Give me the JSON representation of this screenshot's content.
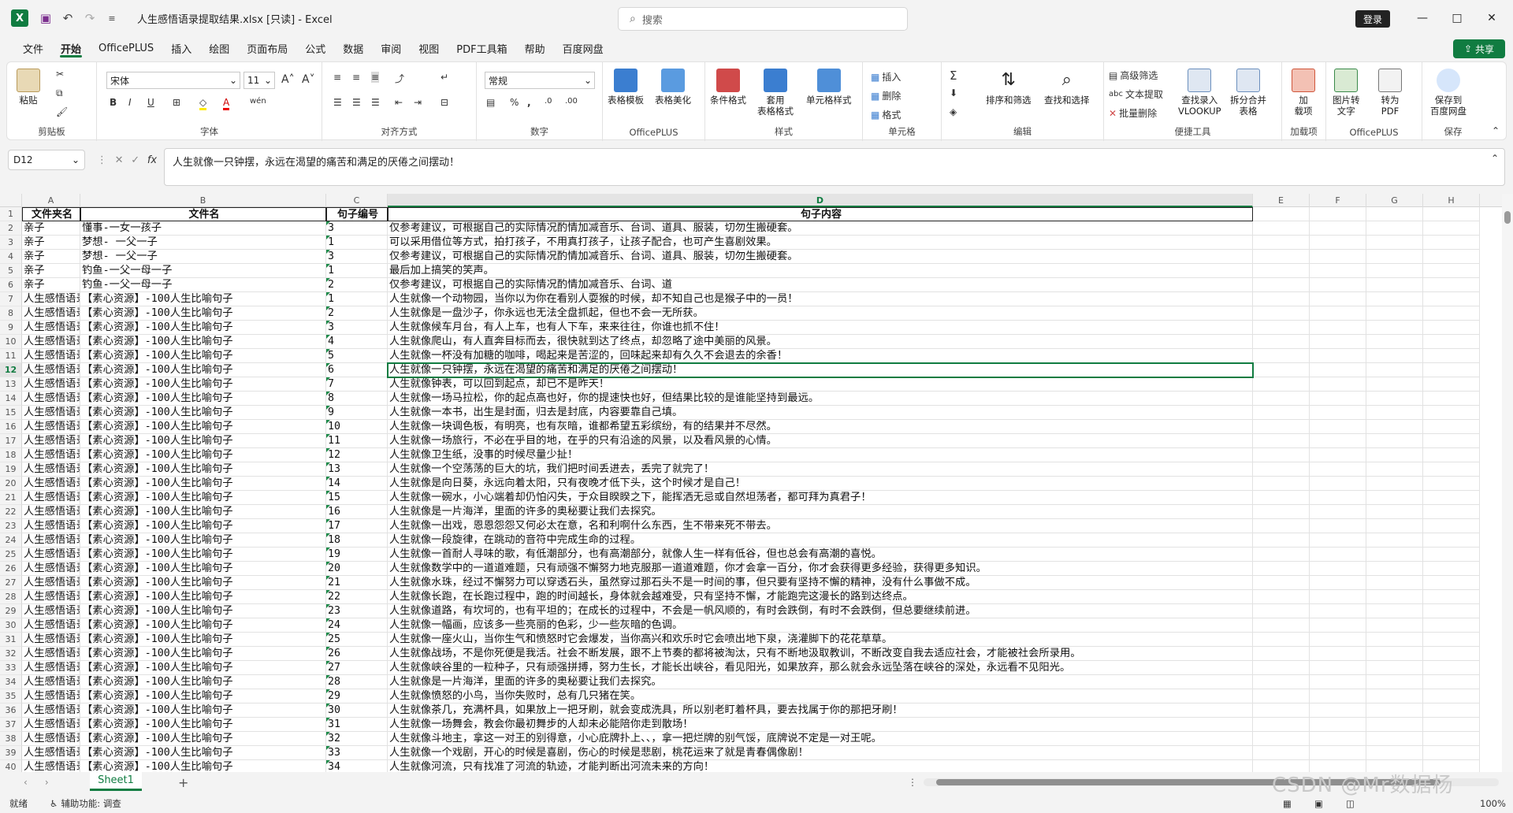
{
  "title_bar": {
    "doc_title": "人生感悟语录提取结果.xlsx  [只读]  -  Excel",
    "search_placeholder": "搜索",
    "login_label": "登录",
    "minimize_glyph": "—",
    "maximize_glyph": "□",
    "close_glyph": "✕",
    "undo_glyph": "↶",
    "redo_glyph": "↷",
    "qat_glyph": "≡",
    "logo_letter": "X"
  },
  "menu": {
    "items": [
      "文件",
      "开始",
      "OfficePLUS",
      "插入",
      "绘图",
      "页面布局",
      "公式",
      "数据",
      "审阅",
      "视图",
      "PDF工具箱",
      "帮助",
      "百度网盘"
    ],
    "active_index": 1,
    "share_label": "共享"
  },
  "ribbon": {
    "groups": [
      "剪贴板",
      "字体",
      "对齐方式",
      "数字",
      "OfficePLUS",
      "样式",
      "单元格",
      "编辑",
      "便捷工具",
      "加载项",
      "OfficePLUS",
      "保存"
    ],
    "paste_label": "粘贴",
    "font_name": "宋体",
    "font_size": "11",
    "number_format": "常规",
    "bold": "B",
    "italic": "I",
    "underline": "U",
    "table_template": "表格模板",
    "table_beautify": "表格美化",
    "conditional_format": "条件格式",
    "apply_table_format": "套用\n表格格式",
    "cell_style": "单元格样式",
    "insert": "插入",
    "delete": "删除",
    "format": "格式",
    "sum_glyph": "Σ",
    "sort_filter": "排序和筛选",
    "find_select": "查找和选择",
    "advanced_filter": "高级筛选",
    "text_extract": "文本提取",
    "batch_delete": "批量删除",
    "lookup_entry": "查找录入\nVLOOKUP",
    "split_merge": "拆分合并\n表格",
    "addins": "加\n载项",
    "img_to_text": "图片转\n文字",
    "to_pdf": "转为\nPDF",
    "save_baidu": "保存到\n百度网盘"
  },
  "formula_bar": {
    "name_box": "D12",
    "fx_label": "fx",
    "content": "人生就像一只钟摆，永远在渴望的痛苦和满足的厌倦之间摆动！"
  },
  "grid": {
    "columns": [
      "A",
      "B",
      "C",
      "D",
      "E",
      "F",
      "G",
      "H"
    ],
    "selected_column": "D",
    "selected_row": 12,
    "rows": [
      [
        "文件夹名",
        "文件名",
        "句子编号",
        "句子内容"
      ],
      [
        "亲子",
        "懂事-一女一孩子",
        "3",
        "仅参考建议，可根据自己的实际情况酌情加减音乐、台词、道具、服装，切勿生搬硬套。"
      ],
      [
        "亲子",
        "梦想- 一父一子",
        "1",
        "可以采用借位等方式，拍打孩子，不用真打孩子，让孩子配合，也可产生喜剧效果。"
      ],
      [
        "亲子",
        "梦想- 一父一子",
        "3",
        "仅参考建议，可根据自己的实际情况酌情加减音乐、台词、道具、服装，切勿生搬硬套。"
      ],
      [
        "亲子",
        "钓鱼-一父一母一子",
        "1",
        "最后加上搞笑的笑声。"
      ],
      [
        "亲子",
        "钓鱼-一父一母一子",
        "2",
        "仅参考建议，可根据自己的实际情况酌情加减音乐、台词、道"
      ],
      [
        "人生感悟语录",
        "【素心资源】-100人生比喻句子",
        "1",
        "人生就像一个动物园，当你以为你在看别人耍猴的时候，却不知自己也是猴子中的一员！"
      ],
      [
        "人生感悟语录",
        "【素心资源】-100人生比喻句子",
        "2",
        "人生就像是一盘沙子，你永远也无法全盘抓起，但也不会一无所获。"
      ],
      [
        "人生感悟语录",
        "【素心资源】-100人生比喻句子",
        "3",
        "人生就像候车月台，有人上车，也有人下车，来来往往，你谁也抓不住！"
      ],
      [
        "人生感悟语录",
        "【素心资源】-100人生比喻句子",
        "4",
        "人生就像爬山，有人直奔目标而去，很快就到达了终点，却忽略了途中美丽的风景。"
      ],
      [
        "人生感悟语录",
        "【素心资源】-100人生比喻句子",
        "5",
        "人生就像一杯没有加糖的咖啡，喝起来是苦涩的，回味起来却有久久不会退去的余香！"
      ],
      [
        "人生感悟语录",
        "【素心资源】-100人生比喻句子",
        "6",
        "人生就像一只钟摆，永远在渴望的痛苦和满足的厌倦之间摆动！"
      ],
      [
        "人生感悟语录",
        "【素心资源】-100人生比喻句子",
        "7",
        "人生就像钟表，可以回到起点，却已不是昨天！"
      ],
      [
        "人生感悟语录",
        "【素心资源】-100人生比喻句子",
        "8",
        "人生就像一场马拉松，你的起点高也好，你的提速快也好，但结果比较的是谁能坚持到最远。"
      ],
      [
        "人生感悟语录",
        "【素心资源】-100人生比喻句子",
        "9",
        "人生就像一本书，出生是封面，归去是封底，内容要靠自己填。"
      ],
      [
        "人生感悟语录",
        "【素心资源】-100人生比喻句子",
        "10",
        "人生就像一块调色板，有明亮，也有灰暗，谁都希望五彩缤纷，有的结果并不尽然。"
      ],
      [
        "人生感悟语录",
        "【素心资源】-100人生比喻句子",
        "11",
        "人生就像一场旅行，不必在乎目的地，在乎的只有沿途的风景，以及看风景的心情。"
      ],
      [
        "人生感悟语录",
        "【素心资源】-100人生比喻句子",
        "12",
        "人生就像卫生纸，没事的时候尽量少扯！"
      ],
      [
        "人生感悟语录",
        "【素心资源】-100人生比喻句子",
        "13",
        "人生就像一个空荡荡的巨大的坑，我们把时间丢进去，丢完了就完了！"
      ],
      [
        "人生感悟语录",
        "【素心资源】-100人生比喻句子",
        "14",
        "人生就像是向日葵，永远向着太阳，只有夜晚才低下头，这个时候才是自己！"
      ],
      [
        "人生感悟语录",
        "【素心资源】-100人生比喻句子",
        "15",
        "人生就像一碗水，小心端着却仍怕闪失，于众目睽睽之下，能挥洒无忌或自然坦荡者，都可拜为真君子！"
      ],
      [
        "人生感悟语录",
        "【素心资源】-100人生比喻句子",
        "16",
        "人生就像是一片海洋，里面的许多的奥秘要让我们去探究。"
      ],
      [
        "人生感悟语录",
        "【素心资源】-100人生比喻句子",
        "17",
        "人生就像一出戏，恩恩怨怨又何必太在意，名和利啊什么东西，生不带来死不带去。"
      ],
      [
        "人生感悟语录",
        "【素心资源】-100人生比喻句子",
        "18",
        "人生就像一段旋律，在跳动的音符中完成生命的过程。"
      ],
      [
        "人生感悟语录",
        "【素心资源】-100人生比喻句子",
        "19",
        "人生就像一首耐人寻味的歌，有低潮部分，也有高潮部分，就像人生一样有低谷，但也总会有高潮的喜悦。"
      ],
      [
        "人生感悟语录",
        "【素心资源】-100人生比喻句子",
        "20",
        "人生就像数学中的一道道难题，只有顽强不懈努力地克服那一道道难题，你才会拿一百分，你才会获得更多经验，获得更多知识。"
      ],
      [
        "人生感悟语录",
        "【素心资源】-100人生比喻句子",
        "21",
        "人生就像水珠，经过不懈努力可以穿透石头，虽然穿过那石头不是一时间的事，但只要有坚持不懈的精神，没有什么事做不成。"
      ],
      [
        "人生感悟语录",
        "【素心资源】-100人生比喻句子",
        "22",
        "人生就像长跑，在长跑过程中，跑的时间越长，身体就会越难受，只有坚持不懈，才能跑完这漫长的路到达终点。"
      ],
      [
        "人生感悟语录",
        "【素心资源】-100人生比喻句子",
        "23",
        "人生就像道路，有坎坷的，也有平坦的；在成长的过程中，不会是一帆风顺的，有时会跌倒，有时不会跌倒，但总要继续前进。"
      ],
      [
        "人生感悟语录",
        "【素心资源】-100人生比喻句子",
        "24",
        "人生就像一幅画，应该多一些亮丽的色彩，少一些灰暗的色调。"
      ],
      [
        "人生感悟语录",
        "【素心资源】-100人生比喻句子",
        "25",
        "人生就像一座火山，当你生气和愤怒时它会爆发，当你高兴和欢乐时它会喷出地下泉，浇灌脚下的花花草草。"
      ],
      [
        "人生感悟语录",
        "【素心资源】-100人生比喻句子",
        "26",
        "人生就像战场，不是你死便是我活。社会不断发展，跟不上节奏的都将被淘汰，只有不断地汲取教训，不断改变自我去适应社会，才能被社会所录用。"
      ],
      [
        "人生感悟语录",
        "【素心资源】-100人生比喻句子",
        "27",
        "人生就像峡谷里的一粒种子，只有顽强拼搏，努力生长，才能长出峡谷，看见阳光，如果放弃，那么就会永远坠落在峡谷的深处，永远看不见阳光。"
      ],
      [
        "人生感悟语录",
        "【素心资源】-100人生比喻句子",
        "28",
        "人生就像是一片海洋，里面的许多的奥秘要让我们去探究。"
      ],
      [
        "人生感悟语录",
        "【素心资源】-100人生比喻句子",
        "29",
        "人生就像愤怒的小鸟，当你失败时，总有几只猪在笑。"
      ],
      [
        "人生感悟语录",
        "【素心资源】-100人生比喻句子",
        "30",
        "人生就像茶几，充满杯具，如果放上一把牙刷，就会变成洗具，所以别老盯着杯具，要去找属于你的那把牙刷！"
      ],
      [
        "人生感悟语录",
        "【素心资源】-100人生比喻句子",
        "31",
        "人生就像一场舞会，教会你最初舞步的人却未必能陪你走到散场！"
      ],
      [
        "人生感悟语录",
        "【素心资源】-100人生比喻句子",
        "32",
        "人生就像斗地主，拿这一对王的别得意，小心庇牌扑上、、，拿一把烂牌的别气馁，底牌说不定是一对王呢。"
      ],
      [
        "人生感悟语录",
        "【素心资源】-100人生比喻句子",
        "33",
        "人生就像一个戏剧，开心的时候是喜剧，伤心的时候是悲剧，桃花运来了就是青春偶像剧！"
      ],
      [
        "人生感悟语录",
        "【素心资源】-100人生比喻句子",
        "34",
        "人生就像河流，只有找准了河流的轨迹，才能判断出河流未来的方向！"
      ]
    ]
  },
  "sheets": {
    "active": "Sheet1",
    "add_glyph": "+"
  },
  "status": {
    "mode": "就绪",
    "accessibility": "辅助功能: 调查",
    "zoom": "100%"
  },
  "watermark": "CSDN @Mr数据杨"
}
